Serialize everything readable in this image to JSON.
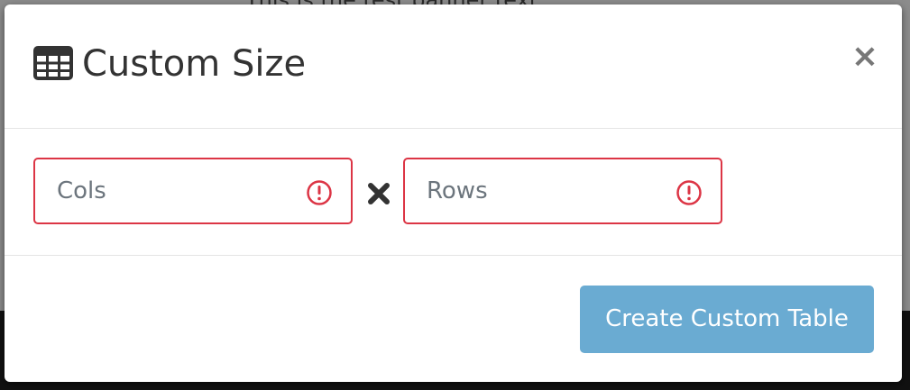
{
  "background": {
    "banner_text": "This is the test banner text"
  },
  "modal": {
    "title": "Custom Size",
    "title_icon": "table-icon",
    "close_label": "×",
    "fields": {
      "cols": {
        "value": "",
        "placeholder": "Cols",
        "state": "invalid"
      },
      "rows": {
        "value": "",
        "placeholder": "Rows",
        "state": "invalid"
      }
    },
    "separator_icon": "times-icon",
    "create_button_label": "Create Custom Table"
  },
  "colors": {
    "error": "#dc3545",
    "primary_disabled": "#6aabd2",
    "text": "#333333"
  }
}
